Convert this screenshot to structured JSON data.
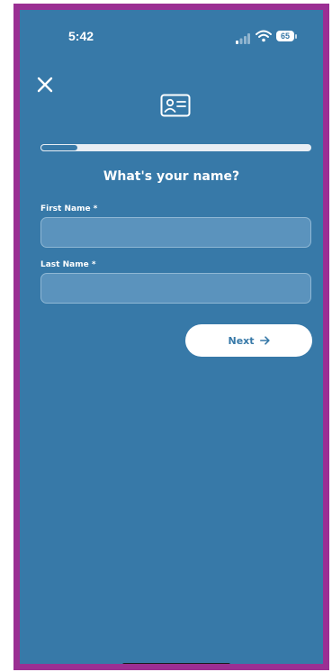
{
  "status_bar": {
    "time": "5:42",
    "battery": "65"
  },
  "header": {
    "close_icon": "close-icon",
    "badge_icon": "id-card-icon"
  },
  "progress": {
    "fraction": 0.14
  },
  "form": {
    "title": "What's your name?",
    "first_name": {
      "label": "First Name *",
      "value": "",
      "placeholder": ""
    },
    "last_name": {
      "label": "Last Name *",
      "value": "",
      "placeholder": ""
    },
    "next_label": "Next",
    "next_icon": "arrow-right-icon"
  },
  "colors": {
    "background": "#3779a8",
    "frame": "#9b2f93",
    "button": "#ffffff",
    "button_text": "#3779a8"
  }
}
